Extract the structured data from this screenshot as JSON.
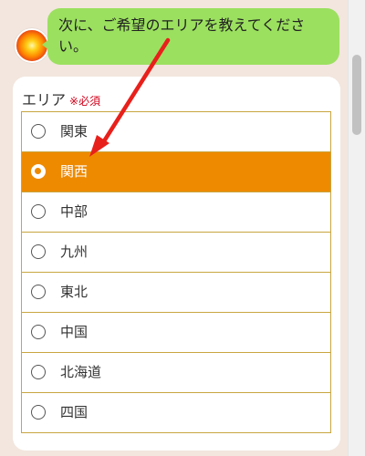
{
  "chat": {
    "message": "次に、ご希望のエリアを教えてください。"
  },
  "form": {
    "label": "エリア",
    "required_mark": "※必須",
    "options": [
      {
        "label": "関東",
        "selected": false
      },
      {
        "label": "関西",
        "selected": true
      },
      {
        "label": "中部",
        "selected": false
      },
      {
        "label": "九州",
        "selected": false
      },
      {
        "label": "東北",
        "selected": false
      },
      {
        "label": "中国",
        "selected": false
      },
      {
        "label": "北海道",
        "selected": false
      },
      {
        "label": "四国",
        "selected": false
      }
    ]
  },
  "colors": {
    "bubble": "#9be05f",
    "selected": "#ee8a00",
    "border": "#c8a640",
    "arrow": "#e8201b",
    "required": "#d0021b"
  },
  "icons": {
    "avatar": "sun-avatar-icon",
    "arrow": "red-pointer-arrow"
  }
}
